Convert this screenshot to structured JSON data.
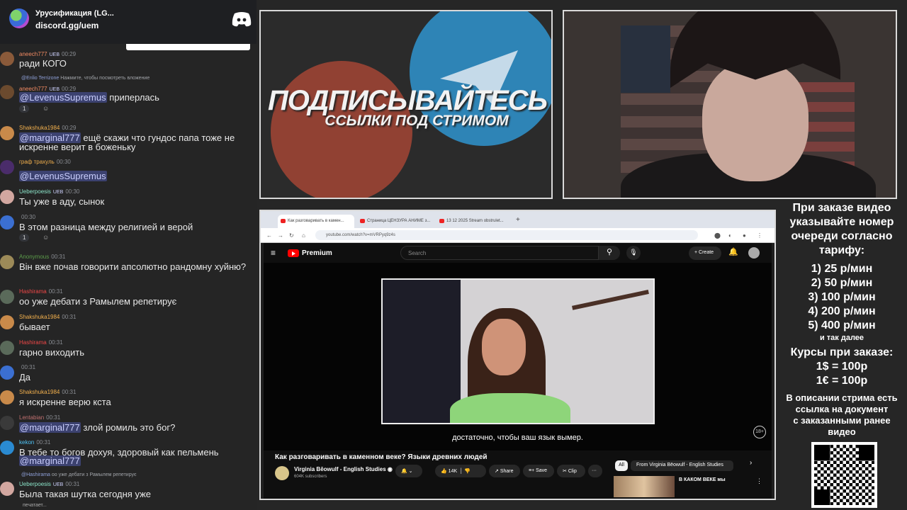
{
  "server": {
    "title": "Урусификация (LG...",
    "invite": "discord.gg/uem"
  },
  "messages": [
    {
      "user": "aneech777",
      "badge": "UEB",
      "time": "00:29",
      "text": "ради КОГО"
    },
    {
      "reply_user": "@Enlio Terrizone",
      "reply_text": "Нажмите, чтобы посмотреть вложение",
      "user": "aneech777",
      "badge": "UEB",
      "time": "00:29",
      "mention": "@LevenusSupremus",
      "text": "приперлась",
      "reaction": "1"
    },
    {
      "user": "Shakshuka1984",
      "time": "00:29",
      "mention": "@marginal777",
      "text": "ещё скажи что гундос папа тоже не",
      "text2": "искренне верит в боженьку"
    },
    {
      "user": "граф трахуль",
      "time": "00:30",
      "mention": "@LevenusSupremus"
    },
    {
      "user": "Ueberpoesis",
      "badge": "UEB",
      "time": "00:30",
      "text": "Ты уже в аду, сынок"
    },
    {
      "user": "",
      "time": "00:30",
      "text": "В этом разница между религией и верой",
      "reaction": "1"
    },
    {
      "user": "Anonymous",
      "time": "00:31",
      "text": "Він вже почав говорити апсолютно рандомну хуйню?"
    },
    {
      "user": "Hashirama",
      "time": "00:31",
      "text": "оо уже дебати з Рамылем репетирує"
    },
    {
      "user": "Shakshuka1984",
      "time": "00:31",
      "text": "бывает"
    },
    {
      "user": "Hashirama",
      "time": "00:31",
      "text": "гарно виходить"
    },
    {
      "user": "",
      "time": "00:31",
      "text": "Да"
    },
    {
      "user": "Shakshuka1984",
      "time": "00:31",
      "text": "я искренне верю кста"
    },
    {
      "user": "Lentabian",
      "time": "00:31",
      "mention": "@marginal777",
      "text": "злой ромиль это бог?"
    },
    {
      "user": "kekon",
      "time": "00:31",
      "text": "В тебе то богов дохуя, здоровый как пельмень",
      "mention2": "@marginal777"
    },
    {
      "reply_user": "@Hashirama",
      "reply_text": "оо уже дебати з Рамылем репетирує",
      "user": "Ueberpoesis",
      "badge": "UEB",
      "time": "00:31",
      "text": "Была такая шутка сегодня уже"
    }
  ],
  "typing": "печатает...",
  "promo": {
    "line1": "ПОДПИСЫВАЙТЕСЬ",
    "line2": "ССЫЛКИ ПОД СТРИМОМ"
  },
  "browser": {
    "tabs": [
      "Как разговаривать в камен...",
      "Страница ЦЕНЗУРА АНИМЕ з...",
      "13 12 2025 Stream obstrulet..."
    ],
    "url": "youtube.com/watch?v=mVRPyq9z4s"
  },
  "youtube": {
    "brand": "Premium",
    "search_placeholder": "Search",
    "create": "Create",
    "subtitle": "достаточно, чтобы ваш язык вымер.",
    "age": "18+",
    "title": "Как разговаривать в каменном веке? Языки древних людей",
    "channel": "Virginia Bēowulf - English Studies",
    "subs": "604K subscribers",
    "likes": "14K",
    "share": "Share",
    "save": "Save",
    "clip": "Clip",
    "chip_all": "All",
    "chip_from": "From Virginia Bēowulf - English Studies",
    "rec_title": "В КАКОМ ВЕКЕ мы"
  },
  "info": {
    "header": [
      "При заказе видео",
      "указывайте номер",
      "очереди согласно",
      "тарифу:"
    ],
    "tariffs": [
      "1) 25 р/мин",
      "2) 50 р/мин",
      "3) 100 р/мин",
      "4) 200 р/мин",
      "5) 400 р/мин"
    ],
    "etc": "и так далее",
    "rates_title": "Курсы при заказе:",
    "rates": [
      "1$ = 100р",
      "1€ = 100р"
    ],
    "footer": [
      "В описании стрима есть",
      "ссылка на документ",
      "с заказанными ранее",
      "видео"
    ]
  }
}
